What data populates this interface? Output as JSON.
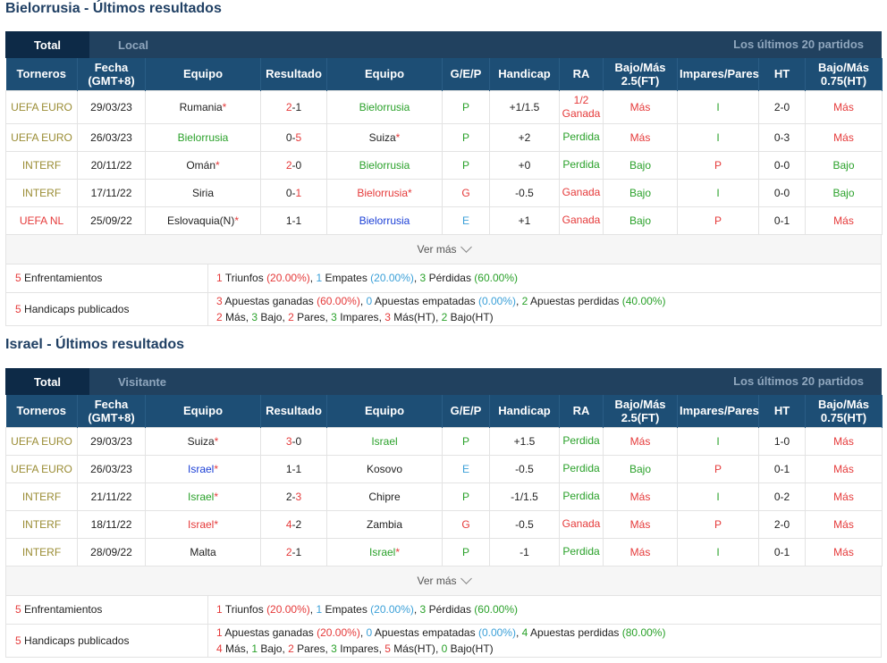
{
  "colors": {
    "olive": "#9a8c34",
    "red": "#e53a3a",
    "green": "#2aa12a",
    "blue": "#1b3fd6",
    "cyan": "#3ba0d8",
    "header": "#1d4e75"
  },
  "headers": [
    "Torneros",
    "Fecha (GMT+8)",
    "Equipo",
    "Resultado",
    "Equipo",
    "G/E/P",
    "Handicap",
    "RA",
    "Bajo/Más 2.5(FT)",
    "Impares/Pares",
    "HT",
    "Bajo/Más 0.75(HT)"
  ],
  "sections": [
    {
      "title": "Bielorrusia - Últimos resultados",
      "tab_total": "Total",
      "tab_side": "Local",
      "tab_right": "Los últimos 20 partidos",
      "ver_mas": "Ver más",
      "rows": [
        {
          "league": "UEFA EURO",
          "league_color": "olive",
          "date": "29/03/23",
          "home": "Rumania",
          "home_color": "dark",
          "home_star": "*",
          "score_h": "2",
          "score_h_color": "red",
          "score_a": "1",
          "score_a_color": "dark",
          "away": "Bielorrusia",
          "away_color": "green",
          "away_star": "",
          "gep": "P",
          "gep_color": "green",
          "handicap": "+1/1.5",
          "ra1": "1/2",
          "ra2": "Ganada",
          "ra_color": "red",
          "ou": "Más",
          "ou_color": "red",
          "op": "I",
          "op_color": "green",
          "ht": "2-0",
          "ht_ou": "Más",
          "ht_ou_color": "red"
        },
        {
          "league": "UEFA EURO",
          "league_color": "olive",
          "date": "26/03/23",
          "home": "Bielorrusia",
          "home_color": "green",
          "home_star": "",
          "score_h": "0",
          "score_h_color": "dark",
          "score_a": "5",
          "score_a_color": "red",
          "away": "Suiza",
          "away_color": "dark",
          "away_star": "*",
          "gep": "P",
          "gep_color": "green",
          "handicap": "+2",
          "ra1": "Perdida",
          "ra2": "",
          "ra_color": "green",
          "ou": "Más",
          "ou_color": "red",
          "op": "I",
          "op_color": "green",
          "ht": "0-3",
          "ht_ou": "Más",
          "ht_ou_color": "red"
        },
        {
          "league": "INTERF",
          "league_color": "olive",
          "date": "20/11/22",
          "home": "Omán",
          "home_color": "dark",
          "home_star": "*",
          "score_h": "2",
          "score_h_color": "red",
          "score_a": "0",
          "score_a_color": "dark",
          "away": "Bielorrusia",
          "away_color": "green",
          "away_star": "",
          "gep": "P",
          "gep_color": "green",
          "handicap": "+0",
          "ra1": "Perdida",
          "ra2": "",
          "ra_color": "green",
          "ou": "Bajo",
          "ou_color": "green",
          "op": "P",
          "op_color": "red",
          "ht": "0-0",
          "ht_ou": "Bajo",
          "ht_ou_color": "green"
        },
        {
          "league": "INTERF",
          "league_color": "olive",
          "date": "17/11/22",
          "home": "Siria",
          "home_color": "dark",
          "home_star": "",
          "score_h": "0",
          "score_h_color": "dark",
          "score_a": "1",
          "score_a_color": "red",
          "away": "Bielorrusia",
          "away_color": "red",
          "away_star": "*",
          "gep": "G",
          "gep_color": "red",
          "handicap": "-0.5",
          "ra1": "Ganada",
          "ra2": "",
          "ra_color": "red",
          "ou": "Bajo",
          "ou_color": "green",
          "op": "I",
          "op_color": "green",
          "ht": "0-0",
          "ht_ou": "Bajo",
          "ht_ou_color": "green"
        },
        {
          "league": "UEFA NL",
          "league_color": "red",
          "date": "25/09/22",
          "home": "Eslovaquia(N)",
          "home_color": "dark",
          "home_star": "*",
          "score_h": "1",
          "score_h_color": "dark",
          "score_a": "1",
          "score_a_color": "dark",
          "away": "Bielorrusia",
          "away_color": "blue",
          "away_star": "",
          "gep": "E",
          "gep_color": "cyan",
          "handicap": "+1",
          "ra1": "Ganada",
          "ra2": "",
          "ra_color": "red",
          "ou": "Bajo",
          "ou_color": "green",
          "op": "P",
          "op_color": "red",
          "ht": "0-1",
          "ht_ou": "Más",
          "ht_ou_color": "red"
        }
      ],
      "summary": {
        "enf_count": "5",
        "enf_label": "Enfrentamientos",
        "wins_n": "1",
        "wins_l": "Triunfos",
        "wins_p": "(20.00%)",
        "draws_n": "1",
        "draws_l": "Empates",
        "draws_p": "(20.00%)",
        "loss_n": "3",
        "loss_l": "Pérdidas",
        "loss_p": "(60.00%)",
        "hc_count": "5",
        "hc_label": "Handicaps publicados",
        "bw_n": "3",
        "bw_l": "Apuestas ganadas",
        "bw_p": "(60.00%)",
        "bd_n": "0",
        "bd_l": "Apuestas empatadas",
        "bd_p": "(0.00%)",
        "bl_n": "2",
        "bl_l": "Apuestas perdidas",
        "bl_p": "(40.00%)",
        "mas_n": "2",
        "mas_l": "Más",
        "bajo_n": "3",
        "bajo_l": "Bajo",
        "pares_n": "2",
        "pares_l": "Pares",
        "imp_n": "3",
        "imp_l": "Impares",
        "masht_n": "3",
        "masht_l": "Más(HT)",
        "bajoht_n": "2",
        "bajoht_l": "Bajo(HT)"
      }
    },
    {
      "title": "Israel - Últimos resultados",
      "tab_total": "Total",
      "tab_side": "Visitante",
      "tab_right": "Los últimos 20 partidos",
      "ver_mas": "Ver más",
      "rows": [
        {
          "league": "UEFA EURO",
          "league_color": "olive",
          "date": "29/03/23",
          "home": "Suiza",
          "home_color": "dark",
          "home_star": "*",
          "score_h": "3",
          "score_h_color": "red",
          "score_a": "0",
          "score_a_color": "dark",
          "away": "Israel",
          "away_color": "green",
          "away_star": "",
          "gep": "P",
          "gep_color": "green",
          "handicap": "+1.5",
          "ra1": "Perdida",
          "ra2": "",
          "ra_color": "green",
          "ou": "Más",
          "ou_color": "red",
          "op": "I",
          "op_color": "green",
          "ht": "1-0",
          "ht_ou": "Más",
          "ht_ou_color": "red"
        },
        {
          "league": "UEFA EURO",
          "league_color": "olive",
          "date": "26/03/23",
          "home": "Israel",
          "home_color": "blue",
          "home_star": "*",
          "score_h": "1",
          "score_h_color": "dark",
          "score_a": "1",
          "score_a_color": "dark",
          "away": "Kosovo",
          "away_color": "dark",
          "away_star": "",
          "gep": "E",
          "gep_color": "cyan",
          "handicap": "-0.5",
          "ra1": "Perdida",
          "ra2": "",
          "ra_color": "green",
          "ou": "Bajo",
          "ou_color": "green",
          "op": "P",
          "op_color": "red",
          "ht": "0-1",
          "ht_ou": "Más",
          "ht_ou_color": "red"
        },
        {
          "league": "INTERF",
          "league_color": "olive",
          "date": "21/11/22",
          "home": "Israel",
          "home_color": "green",
          "home_star": "*",
          "score_h": "2",
          "score_h_color": "dark",
          "score_a": "3",
          "score_a_color": "red",
          "away": "Chipre",
          "away_color": "dark",
          "away_star": "",
          "gep": "P",
          "gep_color": "green",
          "handicap": "-1/1.5",
          "ra1": "Perdida",
          "ra2": "",
          "ra_color": "green",
          "ou": "Más",
          "ou_color": "red",
          "op": "I",
          "op_color": "green",
          "ht": "0-2",
          "ht_ou": "Más",
          "ht_ou_color": "red"
        },
        {
          "league": "INTERF",
          "league_color": "olive",
          "date": "18/11/22",
          "home": "Israel",
          "home_color": "red",
          "home_star": "*",
          "score_h": "4",
          "score_h_color": "red",
          "score_a": "2",
          "score_a_color": "dark",
          "away": "Zambia",
          "away_color": "dark",
          "away_star": "",
          "gep": "G",
          "gep_color": "red",
          "handicap": "-0.5",
          "ra1": "Ganada",
          "ra2": "",
          "ra_color": "red",
          "ou": "Más",
          "ou_color": "red",
          "op": "P",
          "op_color": "red",
          "ht": "2-0",
          "ht_ou": "Más",
          "ht_ou_color": "red"
        },
        {
          "league": "INTERF",
          "league_color": "olive",
          "date": "28/09/22",
          "home": "Malta",
          "home_color": "dark",
          "home_star": "",
          "score_h": "2",
          "score_h_color": "red",
          "score_a": "1",
          "score_a_color": "dark",
          "away": "Israel",
          "away_color": "green",
          "away_star": "*",
          "gep": "P",
          "gep_color": "green",
          "handicap": "-1",
          "ra1": "Perdida",
          "ra2": "",
          "ra_color": "green",
          "ou": "Más",
          "ou_color": "red",
          "op": "I",
          "op_color": "green",
          "ht": "0-1",
          "ht_ou": "Más",
          "ht_ou_color": "red"
        }
      ],
      "summary": {
        "enf_count": "5",
        "enf_label": "Enfrentamientos",
        "wins_n": "1",
        "wins_l": "Triunfos",
        "wins_p": "(20.00%)",
        "draws_n": "1",
        "draws_l": "Empates",
        "draws_p": "(20.00%)",
        "loss_n": "3",
        "loss_l": "Pérdidas",
        "loss_p": "(60.00%)",
        "hc_count": "5",
        "hc_label": "Handicaps publicados",
        "bw_n": "1",
        "bw_l": "Apuestas ganadas",
        "bw_p": "(20.00%)",
        "bd_n": "0",
        "bd_l": "Apuestas empatadas",
        "bd_p": "(0.00%)",
        "bl_n": "4",
        "bl_l": "Apuestas perdidas",
        "bl_p": "(80.00%)",
        "mas_n": "4",
        "mas_l": "Más",
        "bajo_n": "1",
        "bajo_l": "Bajo",
        "pares_n": "2",
        "pares_l": "Pares",
        "imp_n": "3",
        "imp_l": "Impares",
        "masht_n": "5",
        "masht_l": "Más(HT)",
        "bajoht_n": "0",
        "bajoht_l": "Bajo(HT)"
      }
    }
  ]
}
